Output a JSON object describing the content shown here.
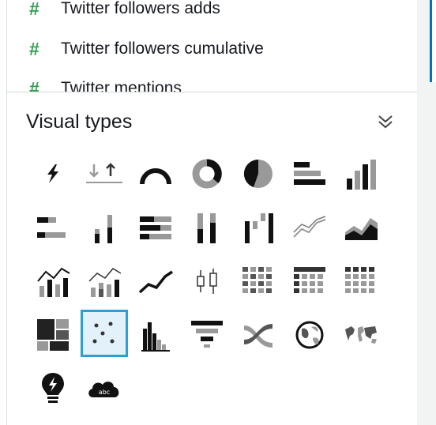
{
  "fields": [
    {
      "name": "Twitter followers adds",
      "type_icon": "hash-icon"
    },
    {
      "name": "Twitter followers cumulative",
      "type_icon": "hash-icon"
    },
    {
      "name": "Twitter mentions",
      "type_icon": "hash-icon"
    }
  ],
  "visual_types": {
    "title": "Visual types",
    "collapse_icon": "double-chevron-down-icon",
    "selected": "scatter-plot",
    "items": [
      "kpi",
      "gauge-delta",
      "donut-arc",
      "donut",
      "pie",
      "horizontal-bar",
      "vertical-bar",
      "horizontal-stacked-bar",
      "vertical-stacked-bar",
      "horizontal-100-stacked-bar",
      "vertical-100-stacked-bar",
      "waterfall",
      "line",
      "area",
      "bar-line-combo",
      "stacked-bar-line-combo",
      "line-area",
      "box-plot",
      "heat-map",
      "pivot-table",
      "table",
      "tree-map",
      "scatter-plot",
      "histogram",
      "funnel",
      "sankey",
      "geospatial",
      "filled-map",
      "insight",
      "word-cloud"
    ]
  },
  "colors": {
    "accent": "#2b9fd6",
    "field_icon": "#2ea04f",
    "icon_dark": "#222222",
    "icon_gray": "#999999"
  }
}
